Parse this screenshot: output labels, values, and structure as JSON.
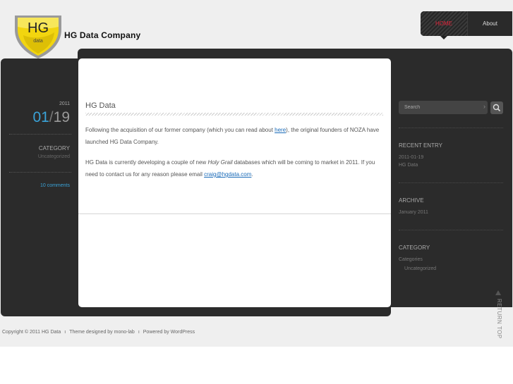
{
  "header": {
    "logo": {
      "top_text": "HG",
      "bottom_text": "data",
      "colors": {
        "shield": "#f2d50f",
        "shield_dark": "#d6b800",
        "rim": "#888888"
      }
    },
    "site_title": "HG Data Company",
    "nav": [
      {
        "label": "HOME",
        "active": true
      },
      {
        "label": "About",
        "active": false
      }
    ]
  },
  "post": {
    "title": "HG Data",
    "date": {
      "year": "2011",
      "month": "01",
      "separator": "/",
      "day": "19"
    },
    "category_label": "CATEGORY",
    "category_value": "Uncategorized",
    "comments": "10 comments",
    "paragraph1": {
      "before_link": "Following the acquisition of our former company (which you can read about ",
      "link_text": "here",
      "after_link": "), the original founders of NOZA have launched HG Data Company."
    },
    "paragraph2": {
      "part1": "HG Data is currently developing a couple of new ",
      "emphasis": "Holy Grail",
      "part2": " databases which will be coming to market in 2011. If you need to contact us for any reason please email ",
      "email": "craig@hgdata.com",
      "part3": "."
    }
  },
  "sidebar": {
    "search": {
      "placeholder": "Search",
      "caret": "›"
    },
    "recent_entry": {
      "heading": "RECENT ENTRY",
      "date": "2011-01-19",
      "title": "HG Data"
    },
    "archive": {
      "heading": "ARCHIVE",
      "item": "January 2011"
    },
    "category": {
      "heading": "CATEGORY",
      "group": "Categories",
      "item": "Uncategorized"
    },
    "return_top": "RETURN TOP"
  },
  "footer": {
    "copyright": "Copyright ©  2011  HG Data",
    "separator": "ı",
    "theme": "Theme designed by mono-lab",
    "powered": "Powered by WordPress"
  },
  "colors": {
    "accent_blue": "#3aa3d8",
    "nav_active_red": "#e1263c",
    "link_blue": "#1a6bb8",
    "dark_panel": "#2b2b2b"
  }
}
